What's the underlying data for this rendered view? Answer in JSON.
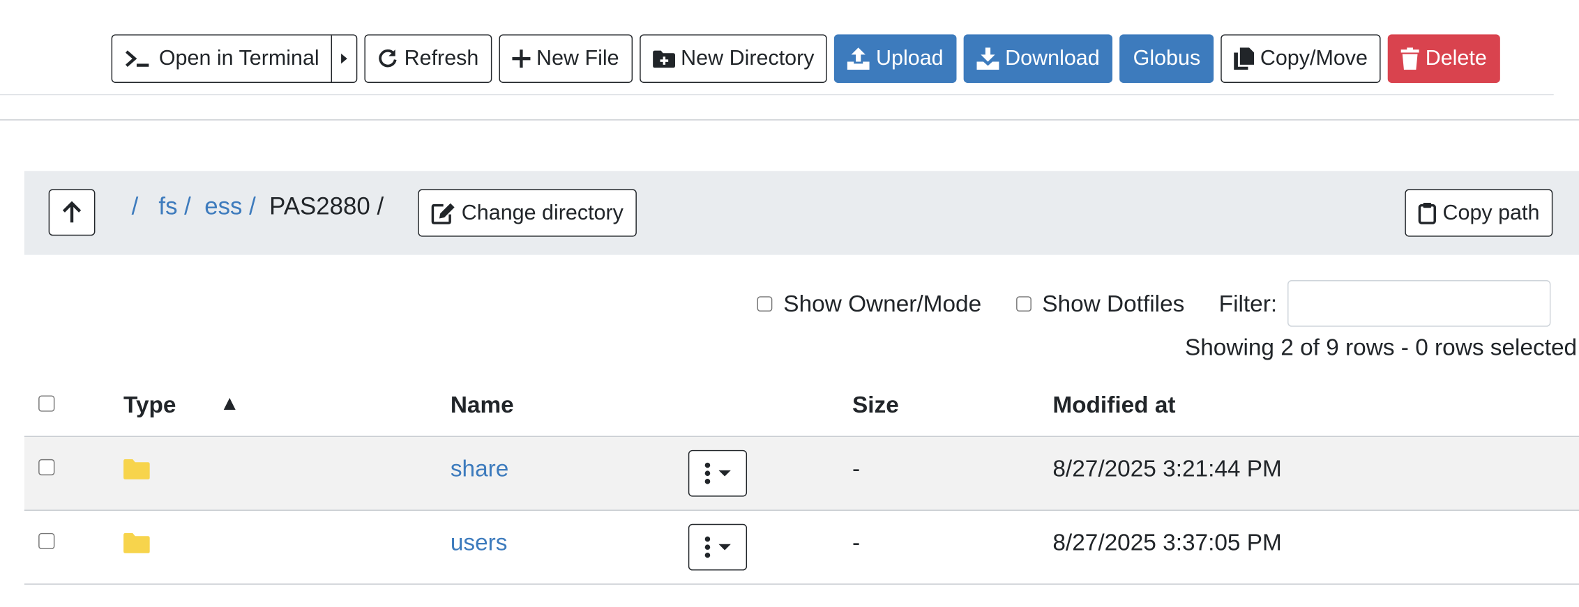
{
  "toolbar": {
    "open_terminal": "Open in Terminal",
    "refresh": "Refresh",
    "new_file": "New File",
    "new_directory": "New Directory",
    "upload": "Upload",
    "download": "Download",
    "globus": "Globus",
    "copy_move": "Copy/Move",
    "delete": "Delete"
  },
  "path": {
    "root": "/",
    "segments": [
      "fs",
      "ess"
    ],
    "separator": "/",
    "current": "PAS2880",
    "change_directory": "Change directory",
    "copy_path": "Copy path"
  },
  "options": {
    "show_owner_mode": "Show Owner/Mode",
    "show_dotfiles": "Show Dotfiles",
    "filter_label": "Filter:",
    "filter_value": "",
    "status": "Showing 2 of 9 rows - 0 rows selected"
  },
  "table": {
    "headers": {
      "type": "Type",
      "type_sort": "▲",
      "name": "Name",
      "size": "Size",
      "modified": "Modified at"
    },
    "rows": [
      {
        "type": "folder",
        "name": "share",
        "size": "-",
        "modified": "8/27/2025 3:21:44 PM"
      },
      {
        "type": "folder",
        "name": "users",
        "size": "-",
        "modified": "8/27/2025 3:37:05 PM"
      }
    ]
  },
  "colors": {
    "primary": "#3d7bbd",
    "danger": "#d9434e",
    "folder": "#f7d44c",
    "pathbar_bg": "#e9ecef"
  }
}
